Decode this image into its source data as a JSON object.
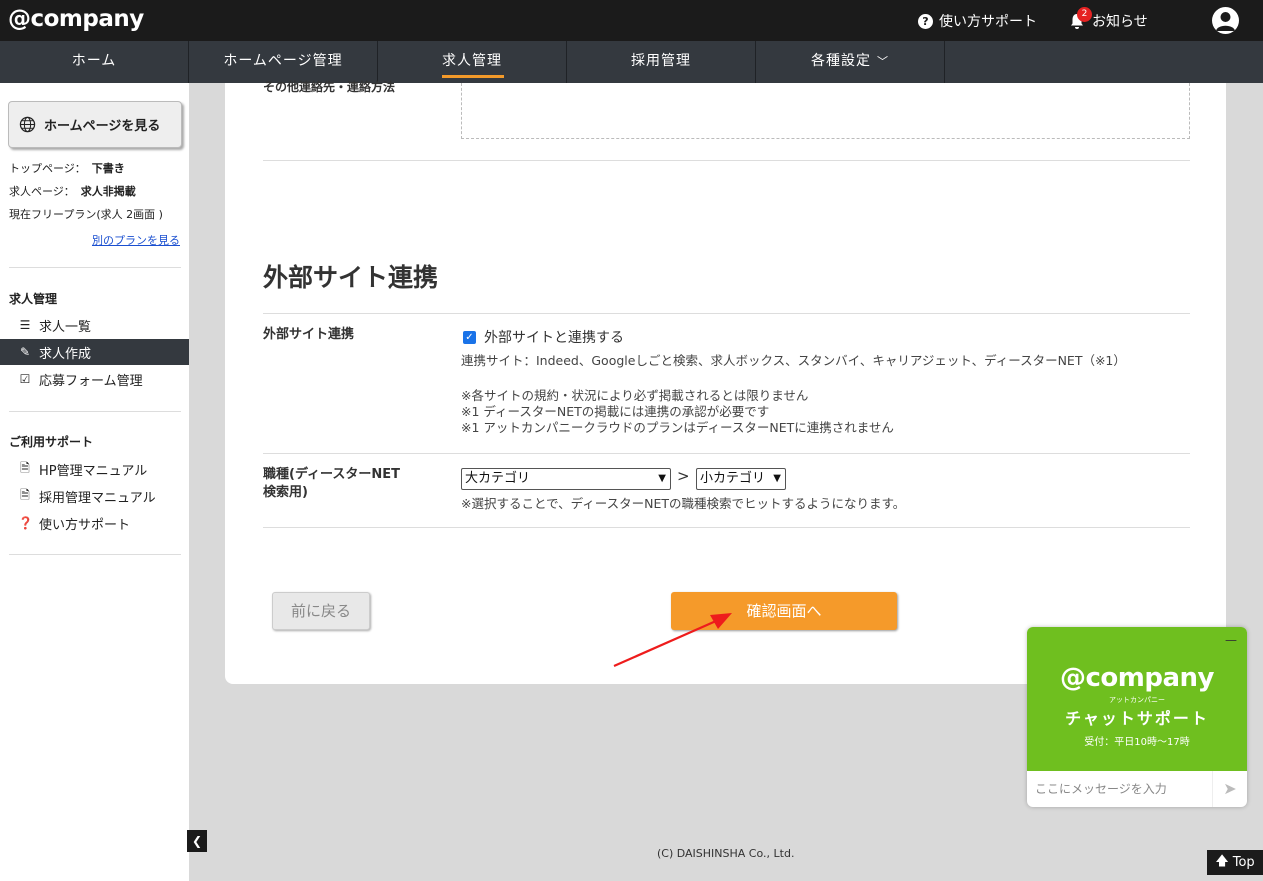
{
  "header": {
    "logo": "@company",
    "support_label": "使い方サポート",
    "notice_label": "お知らせ",
    "notice_count": "2"
  },
  "nav": {
    "items": [
      {
        "label": "ホーム"
      },
      {
        "label": "ホームページ管理"
      },
      {
        "label": "求人管理"
      },
      {
        "label": "採用管理"
      },
      {
        "label": "各種設定"
      }
    ],
    "active_index": 2
  },
  "sidebar": {
    "view_site_button": "ホームページを見る",
    "status": [
      {
        "label": "トップページ：",
        "value": "下書き"
      },
      {
        "label": "求人ページ：",
        "value": "求人非掲載"
      }
    ],
    "plan_text": "現在フリープラン(求人 2画面 )",
    "plan_link": "別のプランを見る",
    "section1_title": "求人管理",
    "section1_items": [
      {
        "label": "求人一覧",
        "icon": "list-icon"
      },
      {
        "label": "求人作成",
        "icon": "edit-icon"
      },
      {
        "label": "応募フォーム管理",
        "icon": "check-square-icon"
      }
    ],
    "section2_title": "ご利用サポート",
    "section2_items": [
      {
        "label": "HP管理マニュアル",
        "icon": "pdf-icon"
      },
      {
        "label": "採用管理マニュアル",
        "icon": "pdf-icon"
      },
      {
        "label": "使い方サポート",
        "icon": "question-icon"
      }
    ]
  },
  "main": {
    "prev_row_label": "その他連絡先・連絡方法",
    "section_title": "外部サイト連携",
    "external": {
      "label": "外部サイト連携",
      "checkbox_label": "外部サイトと連携する",
      "checked": true,
      "sites": "連携サイト：Indeed、Googleしごと検索、求人ボックス、スタンバイ、キャリアジェット、ディースターNET（※1）",
      "notes": [
        "※各サイトの規約・状況により必ず掲載されるとは限りません",
        "※1 ディースターNETの掲載には連携の承認が必要です",
        "※1 アットカンパニークラウドのプランはディースターNETに連携されません"
      ]
    },
    "job_type": {
      "label_line1": "職種(ディースターNET",
      "label_line2": "検索用)",
      "major_select": "大カテゴリ",
      "minor_select": "小カテゴリ",
      "separator": ">",
      "hint": "※選択することで、ディースターNETの職種検索でヒットするようになります。"
    },
    "back_button": "前に戻る",
    "confirm_button": "確認画面へ"
  },
  "footer": {
    "copyright": "(C) DAISHINSHA Co., Ltd.",
    "top_button": "Top"
  },
  "chat": {
    "logo": "@company",
    "kana": "アットカンパニー",
    "title": "チャットサポート",
    "hours": "受付：平日10時～17時",
    "input_placeholder": "ここにメッセージを入力"
  },
  "colors": {
    "accent": "#f59a2a",
    "nav_bg": "#34393f",
    "chat_green": "#6fbf1f"
  }
}
